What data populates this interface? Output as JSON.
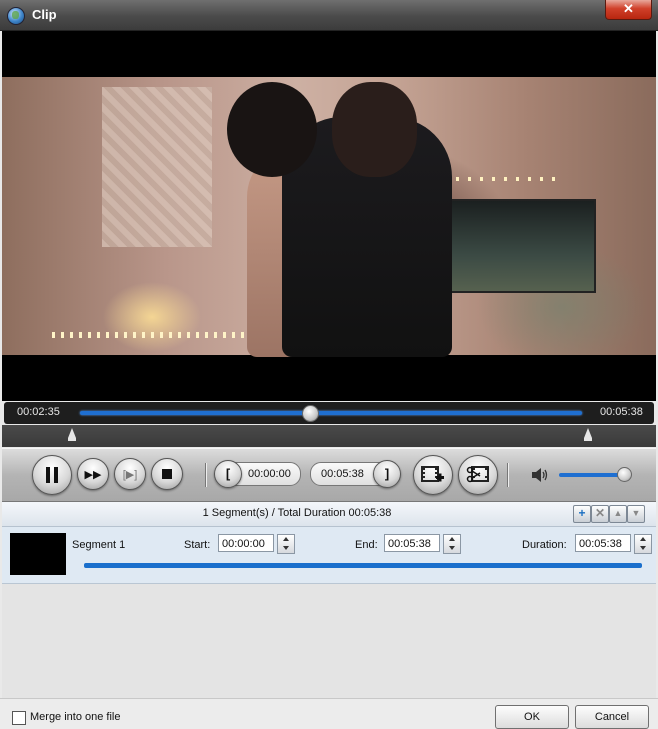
{
  "window": {
    "title": "Clip",
    "close_glyph": "✕"
  },
  "playback": {
    "current_time": "00:02:35",
    "total_time": "00:05:38",
    "progress_fraction": 0.459
  },
  "controls": {
    "clip_start_time": "00:00:00",
    "clip_end_time": "00:05:38",
    "start_bracket": "[",
    "end_bracket": "]",
    "volume_fraction": 0.9
  },
  "segments": {
    "summary": "1 Segment(s) / Total Duration 00:05:38",
    "items": [
      {
        "name": "Segment 1",
        "start_label": "Start:",
        "start": "00:00:00",
        "end_label": "End:",
        "end": "00:05:38",
        "duration_label": "Duration:",
        "duration": "00:05:38"
      }
    ]
  },
  "footer": {
    "merge_label": "Merge into one file",
    "ok_label": "OK",
    "cancel_label": "Cancel"
  }
}
